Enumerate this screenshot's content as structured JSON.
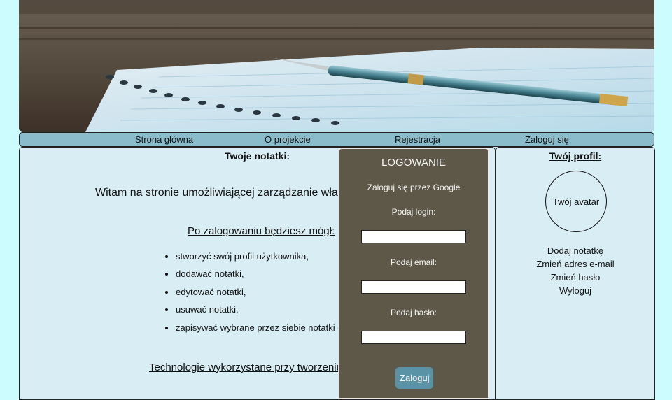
{
  "nav": {
    "items": [
      {
        "label": "Strona główna"
      },
      {
        "label": "O projekcie"
      },
      {
        "label": "Rejestracja"
      },
      {
        "label": "Zaloguj się"
      }
    ]
  },
  "main": {
    "title": "Twoje notatki:",
    "welcome": "Witam na stronie umożliwiającej zarządzanie wła",
    "after_login": "Po zalogowaniu będziesz mógł:",
    "features": [
      "stworzyć swój profil użytkownika,",
      "dodawać notatki,",
      "edytować notatki,",
      "usuwać notatki,",
      "zapisywać wybrane przez siebie notatki d"
    ],
    "technologies": "Technologie wykorzystane przy tworzeniu s"
  },
  "login": {
    "title": "LOGOWANIE",
    "google": "Zaloguj się przez Google",
    "login_label": "Podaj login:",
    "email_label": "Podaj email:",
    "password_label": "Podaj hasło:",
    "login_value": "",
    "email_value": "",
    "password_value": "",
    "submit": "Zaloguj"
  },
  "profile": {
    "title": "Twój profil:",
    "avatar": "Twój avatar",
    "menu": [
      {
        "label": "Dodaj notatkę"
      },
      {
        "label": "Zmień adres e-mail"
      },
      {
        "label": "Zmień hasło"
      },
      {
        "label": "Wyloguj"
      }
    ]
  },
  "colors": {
    "page_bg": "#ccfcfe",
    "nav_bg": "#8bbccc",
    "panel_bg": "#d9edf5",
    "login_bg": "#5e5849",
    "button_bg": "#5a93a5"
  }
}
